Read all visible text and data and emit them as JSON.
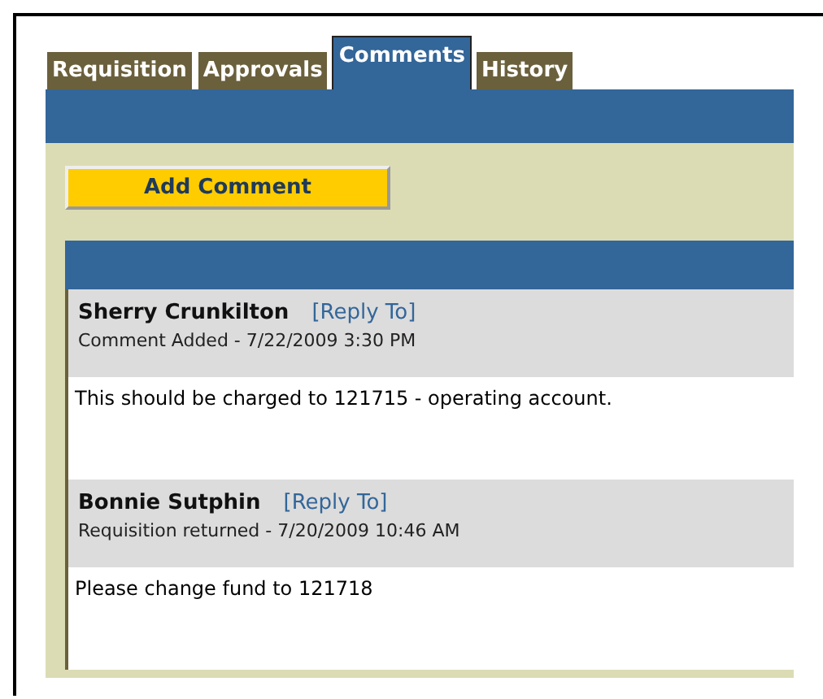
{
  "tabs": [
    {
      "label": "Requisition",
      "selected": false
    },
    {
      "label": "Approvals",
      "selected": false
    },
    {
      "label": "Comments",
      "selected": true
    },
    {
      "label": "History",
      "selected": false
    }
  ],
  "add_button": "Add Comment",
  "comments": [
    {
      "author": "Sherry Crunkilton",
      "reply_link": "[Reply To]",
      "meta": "Comment Added - 7/22/2009 3:30 PM",
      "body": "This should be charged to 121715 - operating account."
    },
    {
      "author": "Bonnie Sutphin",
      "reply_link": "[Reply To]",
      "meta": "Requisition returned - 7/20/2009 10:46 AM",
      "body": "Please change fund to 121718"
    }
  ]
}
